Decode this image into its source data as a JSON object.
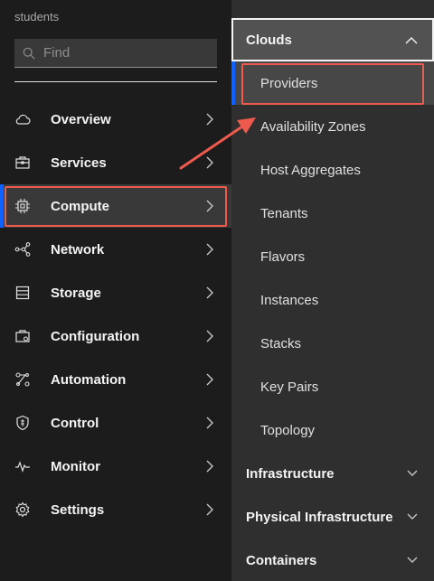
{
  "org": "students",
  "search": {
    "placeholder": "Find"
  },
  "nav": [
    {
      "label": "Overview",
      "icon": "cloud-icon"
    },
    {
      "label": "Services",
      "icon": "toolbox-icon"
    },
    {
      "label": "Compute",
      "icon": "chip-icon"
    },
    {
      "label": "Network",
      "icon": "network-icon"
    },
    {
      "label": "Storage",
      "icon": "storage-icon"
    },
    {
      "label": "Configuration",
      "icon": "configuration-icon"
    },
    {
      "label": "Automation",
      "icon": "automation-icon"
    },
    {
      "label": "Control",
      "icon": "shield-icon"
    },
    {
      "label": "Monitor",
      "icon": "pulse-icon"
    },
    {
      "label": "Settings",
      "icon": "gear-icon"
    }
  ],
  "submenu": {
    "clouds": "Clouds",
    "items": [
      "Providers",
      "Availability Zones",
      "Host Aggregates",
      "Tenants",
      "Flavors",
      "Instances",
      "Stacks",
      "Key Pairs",
      "Topology"
    ],
    "groups": [
      "Infrastructure",
      "Physical Infrastructure",
      "Containers"
    ]
  },
  "colors": {
    "accent": "#0f62fe",
    "highlight": "#ee5a4d"
  }
}
